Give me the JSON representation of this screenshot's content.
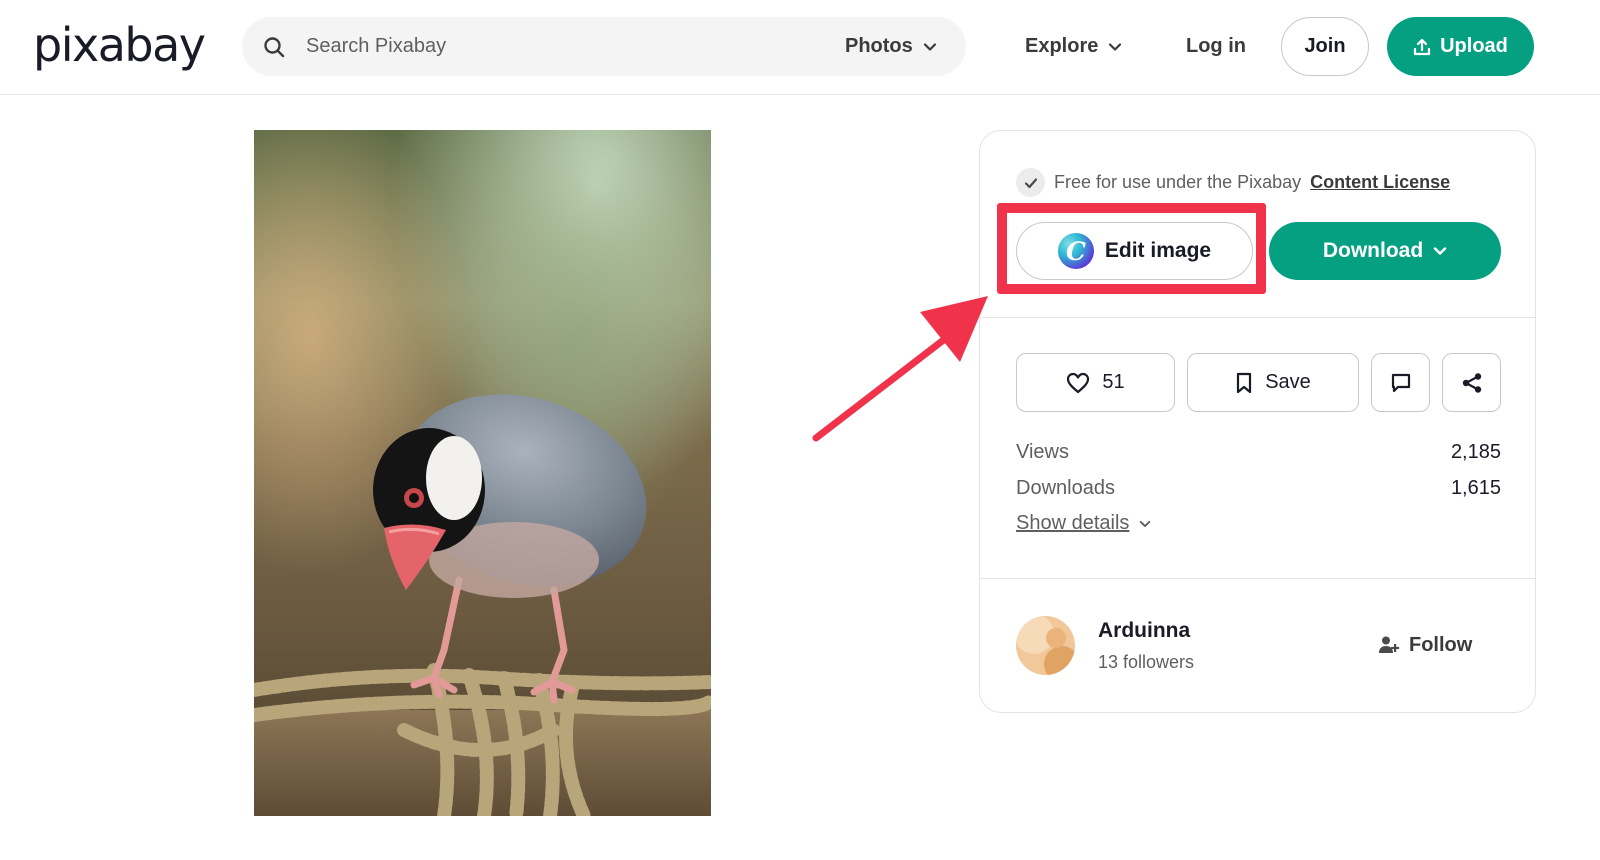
{
  "header": {
    "logo": "pixabay",
    "search_placeholder": "Search Pixabay",
    "search_type": "Photos",
    "explore": "Explore",
    "login": "Log in",
    "join": "Join",
    "upload": "Upload"
  },
  "sidebar": {
    "license_text": "Free for use under the Pixabay",
    "license_link": "Content License",
    "edit_image": "Edit image",
    "download": "Download",
    "likes": "51",
    "save": "Save",
    "stats": [
      {
        "label": "Views",
        "value": "2,185"
      },
      {
        "label": "Downloads",
        "value": "1,615"
      }
    ],
    "show_details": "Show details",
    "user": {
      "name": "Arduinna",
      "followers": "13 followers",
      "follow": "Follow"
    }
  },
  "colors": {
    "accent_green": "#05a081",
    "annotation_red": "#f0334b"
  },
  "icons": [
    "search-icon",
    "chevron-down-icon",
    "upload-icon",
    "check-icon",
    "canva-icon",
    "heart-icon",
    "bookmark-icon",
    "comment-icon",
    "share-icon",
    "add-user-icon"
  ]
}
